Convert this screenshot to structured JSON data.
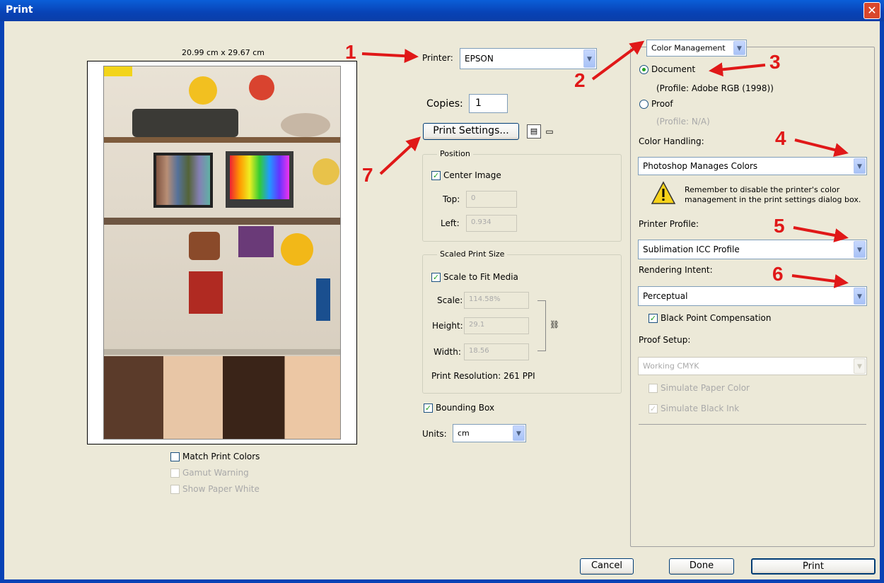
{
  "window": {
    "title": "Print",
    "close_glyph": "✕"
  },
  "preview": {
    "size_label": "20.99 cm x 29.67 cm",
    "checkboxes": [
      {
        "label": "Match Print Colors",
        "checked": false,
        "enabled": true
      },
      {
        "label": "Gamut Warning",
        "checked": false,
        "enabled": false
      },
      {
        "label": "Show Paper White",
        "checked": false,
        "enabled": false
      }
    ]
  },
  "printer": {
    "label": "Printer:",
    "value": "EPSON"
  },
  "copies": {
    "label": "Copies:",
    "value": "1"
  },
  "print_settings": {
    "label": "Print Settings..."
  },
  "position": {
    "title": "Position",
    "center_image": {
      "label": "Center Image",
      "checked": true
    },
    "top": {
      "label": "Top:",
      "value": "0"
    },
    "left": {
      "label": "Left:",
      "value": "0.934"
    }
  },
  "scaled": {
    "title": "Scaled Print Size",
    "scale_to_fit": {
      "label": "Scale to Fit Media",
      "checked": true
    },
    "scale": {
      "label": "Scale:",
      "value": "114.58%"
    },
    "height": {
      "label": "Height:",
      "value": "29.1"
    },
    "width": {
      "label": "Width:",
      "value": "18.56"
    },
    "resolution": "Print Resolution: 261 PPI"
  },
  "bounding_box": {
    "label": "Bounding Box",
    "checked": true
  },
  "units": {
    "label": "Units:",
    "value": "cm"
  },
  "color": {
    "dropdown": "Color Management",
    "document": {
      "label": "Document",
      "selected": true,
      "profile": "(Profile: Adobe RGB (1998))"
    },
    "proof": {
      "label": "Proof",
      "selected": false,
      "profile": "(Profile: N/A)"
    },
    "handling_label": "Color Handling:",
    "handling_value": "Photoshop Manages Colors",
    "warning": "Remember to disable the printer's color management in the print settings dialog box.",
    "printer_profile_label": "Printer Profile:",
    "printer_profile_value": "Sublimation ICC Profile",
    "rendering_label": "Rendering Intent:",
    "rendering_value": "Perceptual",
    "bpc": {
      "label": "Black Point Compensation",
      "checked": true
    },
    "proof_setup_label": "Proof Setup:",
    "proof_setup_value": "Working CMYK",
    "simulate_paper": {
      "label": "Simulate Paper Color",
      "checked": false
    },
    "simulate_ink": {
      "label": "Simulate Black Ink",
      "checked": true
    }
  },
  "buttons": {
    "cancel": "Cancel",
    "done": "Done",
    "print": "Print"
  },
  "annotations": [
    "1",
    "2",
    "3",
    "4",
    "5",
    "6",
    "7"
  ],
  "colors": {
    "annotation": "#e01818",
    "titlebar": "#0842b5",
    "checkmark": "#21a121"
  },
  "icons": [
    "combo-arrow-icon",
    "warning-icon",
    "page-setup-icon",
    "link-chain-icon",
    "close-icon"
  ]
}
